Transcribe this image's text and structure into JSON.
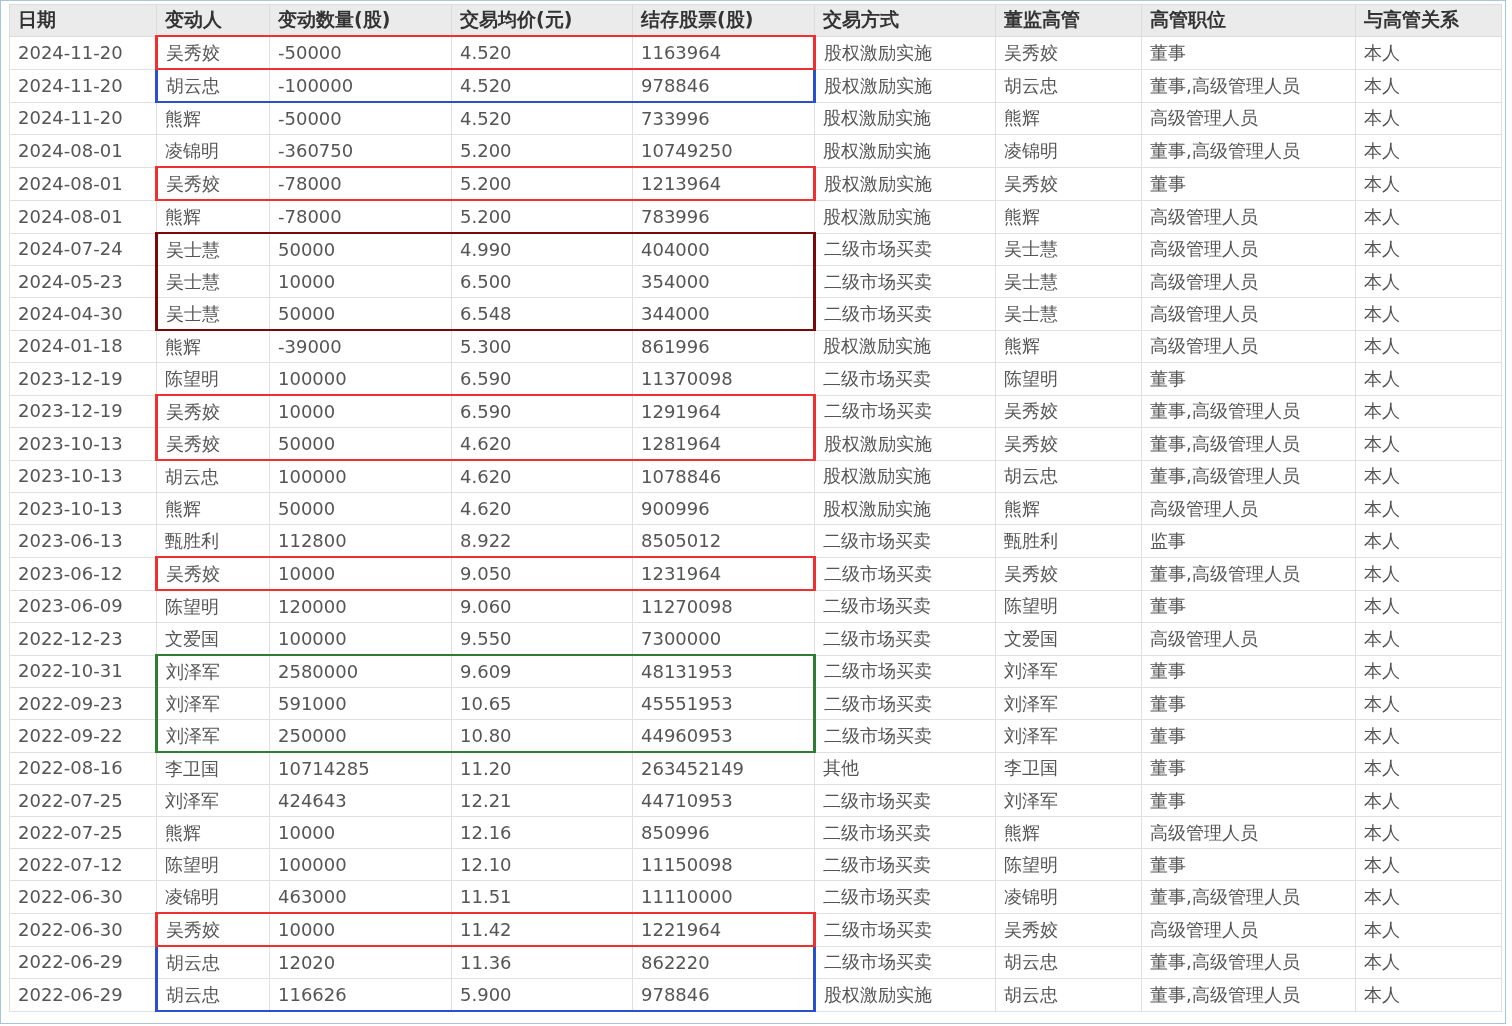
{
  "table": {
    "columns": [
      "日期",
      "变动人",
      "变动数量(股)",
      "交易均价(元)",
      "结存股票(股)",
      "交易方式",
      "董监高管",
      "高管职位",
      "与高管关系"
    ],
    "rows": [
      {
        "cells": [
          "2024-11-20",
          "吴秀姣",
          "-50000",
          "4.520",
          "1163964",
          "股权激励实施",
          "吴秀姣",
          "董事",
          "本人"
        ],
        "color": "#f03030"
      },
      {
        "cells": [
          "2024-11-20",
          "胡云忠",
          "-100000",
          "4.520",
          "978846",
          "股权激励实施",
          "胡云忠",
          "董事,高级管理人员",
          "本人"
        ],
        "color": "#2a4fd0"
      },
      {
        "cells": [
          "2024-11-20",
          "熊辉",
          "-50000",
          "4.520",
          "733996",
          "股权激励实施",
          "熊辉",
          "高级管理人员",
          "本人"
        ]
      },
      {
        "cells": [
          "2024-08-01",
          "凌锦明",
          "-360750",
          "5.200",
          "10749250",
          "股权激励实施",
          "凌锦明",
          "董事,高级管理人员",
          "本人"
        ]
      },
      {
        "cells": [
          "2024-08-01",
          "吴秀姣",
          "-78000",
          "5.200",
          "1213964",
          "股权激励实施",
          "吴秀姣",
          "董事",
          "本人"
        ],
        "color": "#f03030"
      },
      {
        "cells": [
          "2024-08-01",
          "熊辉",
          "-78000",
          "5.200",
          "783996",
          "股权激励实施",
          "熊辉",
          "高级管理人员",
          "本人"
        ]
      },
      {
        "cells": [
          "2024-07-24",
          "吴士慧",
          "50000",
          "4.990",
          "404000",
          "二级市场买卖",
          "吴士慧",
          "高级管理人员",
          "本人"
        ],
        "color": "#7a0a0a"
      },
      {
        "cells": [
          "2024-05-23",
          "吴士慧",
          "10000",
          "6.500",
          "354000",
          "二级市场买卖",
          "吴士慧",
          "高级管理人员",
          "本人"
        ],
        "color": "#7a0a0a"
      },
      {
        "cells": [
          "2024-04-30",
          "吴士慧",
          "50000",
          "6.548",
          "344000",
          "二级市场买卖",
          "吴士慧",
          "高级管理人员",
          "本人"
        ],
        "color": "#7a0a0a"
      },
      {
        "cells": [
          "2024-01-18",
          "熊辉",
          "-39000",
          "5.300",
          "861996",
          "股权激励实施",
          "熊辉",
          "高级管理人员",
          "本人"
        ]
      },
      {
        "cells": [
          "2023-12-19",
          "陈望明",
          "100000",
          "6.590",
          "11370098",
          "二级市场买卖",
          "陈望明",
          "董事",
          "本人"
        ]
      },
      {
        "cells": [
          "2023-12-19",
          "吴秀姣",
          "10000",
          "6.590",
          "1291964",
          "二级市场买卖",
          "吴秀姣",
          "董事,高级管理人员",
          "本人"
        ],
        "color": "#f03030"
      },
      {
        "cells": [
          "2023-10-13",
          "吴秀姣",
          "50000",
          "4.620",
          "1281964",
          "股权激励实施",
          "吴秀姣",
          "董事,高级管理人员",
          "本人"
        ],
        "color": "#f03030"
      },
      {
        "cells": [
          "2023-10-13",
          "胡云忠",
          "100000",
          "4.620",
          "1078846",
          "股权激励实施",
          "胡云忠",
          "董事,高级管理人员",
          "本人"
        ]
      },
      {
        "cells": [
          "2023-10-13",
          "熊辉",
          "50000",
          "4.620",
          "900996",
          "股权激励实施",
          "熊辉",
          "高级管理人员",
          "本人"
        ]
      },
      {
        "cells": [
          "2023-06-13",
          "甄胜利",
          "112800",
          "8.922",
          "8505012",
          "二级市场买卖",
          "甄胜利",
          "监事",
          "本人"
        ]
      },
      {
        "cells": [
          "2023-06-12",
          "吴秀姣",
          "10000",
          "9.050",
          "1231964",
          "二级市场买卖",
          "吴秀姣",
          "董事,高级管理人员",
          "本人"
        ],
        "color": "#f03030"
      },
      {
        "cells": [
          "2023-06-09",
          "陈望明",
          "120000",
          "9.060",
          "11270098",
          "二级市场买卖",
          "陈望明",
          "董事",
          "本人"
        ]
      },
      {
        "cells": [
          "2022-12-23",
          "文爱国",
          "100000",
          "9.550",
          "7300000",
          "二级市场买卖",
          "文爱国",
          "高级管理人员",
          "本人"
        ]
      },
      {
        "cells": [
          "2022-10-31",
          "刘泽军",
          "2580000",
          "9.609",
          "48131953",
          "二级市场买卖",
          "刘泽军",
          "董事",
          "本人"
        ],
        "color": "#2e7d32"
      },
      {
        "cells": [
          "2022-09-23",
          "刘泽军",
          "591000",
          "10.65",
          "45551953",
          "二级市场买卖",
          "刘泽军",
          "董事",
          "本人"
        ],
        "color": "#2e7d32"
      },
      {
        "cells": [
          "2022-09-22",
          "刘泽军",
          "250000",
          "10.80",
          "44960953",
          "二级市场买卖",
          "刘泽军",
          "董事",
          "本人"
        ],
        "color": "#2e7d32"
      },
      {
        "cells": [
          "2022-08-16",
          "李卫国",
          "10714285",
          "11.20",
          "263452149",
          "其他",
          "李卫国",
          "董事",
          "本人"
        ]
      },
      {
        "cells": [
          "2022-07-25",
          "刘泽军",
          "424643",
          "12.21",
          "44710953",
          "二级市场买卖",
          "刘泽军",
          "董事",
          "本人"
        ]
      },
      {
        "cells": [
          "2022-07-25",
          "熊辉",
          "10000",
          "12.16",
          "850996",
          "二级市场买卖",
          "熊辉",
          "高级管理人员",
          "本人"
        ]
      },
      {
        "cells": [
          "2022-07-12",
          "陈望明",
          "100000",
          "12.10",
          "11150098",
          "二级市场买卖",
          "陈望明",
          "董事",
          "本人"
        ]
      },
      {
        "cells": [
          "2022-06-30",
          "凌锦明",
          "463000",
          "11.51",
          "11110000",
          "二级市场买卖",
          "凌锦明",
          "董事,高级管理人员",
          "本人"
        ]
      },
      {
        "cells": [
          "2022-06-30",
          "吴秀姣",
          "10000",
          "11.42",
          "1221964",
          "二级市场买卖",
          "吴秀姣",
          "高级管理人员",
          "本人"
        ],
        "color": "#f03030"
      },
      {
        "cells": [
          "2022-06-29",
          "胡云忠",
          "12020",
          "11.36",
          "862220",
          "二级市场买卖",
          "胡云忠",
          "董事,高级管理人员",
          "本人"
        ],
        "color": "#2a4fd0"
      },
      {
        "cells": [
          "2022-06-29",
          "胡云忠",
          "116626",
          "5.900",
          "978846",
          "股权激励实施",
          "胡云忠",
          "董事,高级管理人员",
          "本人"
        ],
        "color": "#2a4fd0"
      }
    ]
  }
}
